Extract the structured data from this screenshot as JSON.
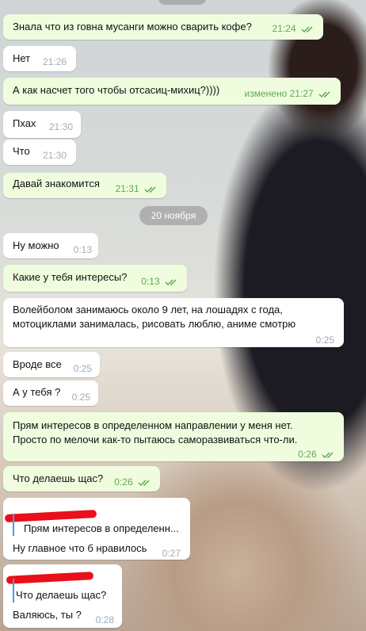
{
  "date_divider": "20 ноября",
  "messages": [
    {
      "text": "Знала что из говна мусанги можно сварить кофе?",
      "time": "21:24"
    },
    {
      "text": "Нет",
      "time": "21:26"
    },
    {
      "text": "А как насчет того чтобы отсасиц-михиц?))))",
      "edited": "изменено",
      "time": "21:27"
    },
    {
      "text": "Пхах",
      "time": "21:30"
    },
    {
      "text": "Что",
      "time": "21:30"
    },
    {
      "text": "Давай знакомится",
      "time": "21:31"
    },
    {
      "text": "Ну можно",
      "time": "0:13"
    },
    {
      "text": "Какие у тебя интересы?",
      "time": "0:13"
    },
    {
      "line1": "Волейболом занимаюсь около 9 лет, на лошадях с года,",
      "line2": "мотоциклами занималась, рисовать люблю, аниме смотрю",
      "time": "0:25"
    },
    {
      "text": "Вроде все",
      "time": "0:25"
    },
    {
      "text": "А у тебя ?",
      "time": "0:25"
    },
    {
      "line1": "Прям интересов в определенном направлении у меня нет.",
      "line2": "Просто по мелочи как-то пытаюсь саморазвиваться что-ли.",
      "time": "0:26"
    },
    {
      "text": "Что делаешь щас?",
      "time": "0:26"
    },
    {
      "quote": "Прям интересов в определенн...",
      "text": "Ну главное что б нравилось",
      "time": "0:27"
    },
    {
      "quote": "Что делаешь щас?",
      "text": "Валяюсь, ты ?",
      "time": "0:28"
    }
  ],
  "colors": {
    "outgoing_bubble": "#effdde",
    "incoming_bubble": "#ffffff",
    "outgoing_meta": "#5fa84f",
    "incoming_meta": "#a0acb6",
    "reply_bar": "#4a9bd8"
  },
  "icons": {
    "read_receipt": "double-check-icon"
  }
}
